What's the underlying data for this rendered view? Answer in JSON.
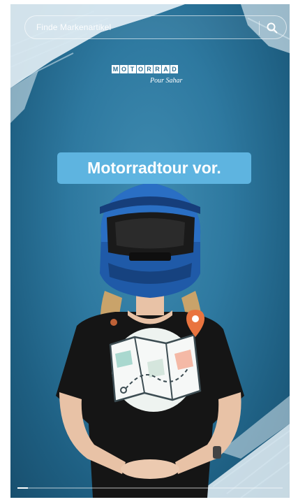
{
  "search": {
    "placeholder": "Finde Markenartikel"
  },
  "logo": {
    "letters": [
      "M",
      "O",
      "T",
      "O",
      "R",
      "R",
      "A",
      "D"
    ],
    "tagline": "Pour Sahar"
  },
  "headline": {
    "text": "Motorradtour vor."
  },
  "progress": {
    "fraction": 0.04
  },
  "colors": {
    "background": "#2e79a0",
    "headline_box": "#5eb4e0",
    "helmet": "#1f5aa8",
    "shirt": "#151515"
  },
  "icons": [
    "search-icon",
    "map-icon",
    "location-pin-icon"
  ]
}
